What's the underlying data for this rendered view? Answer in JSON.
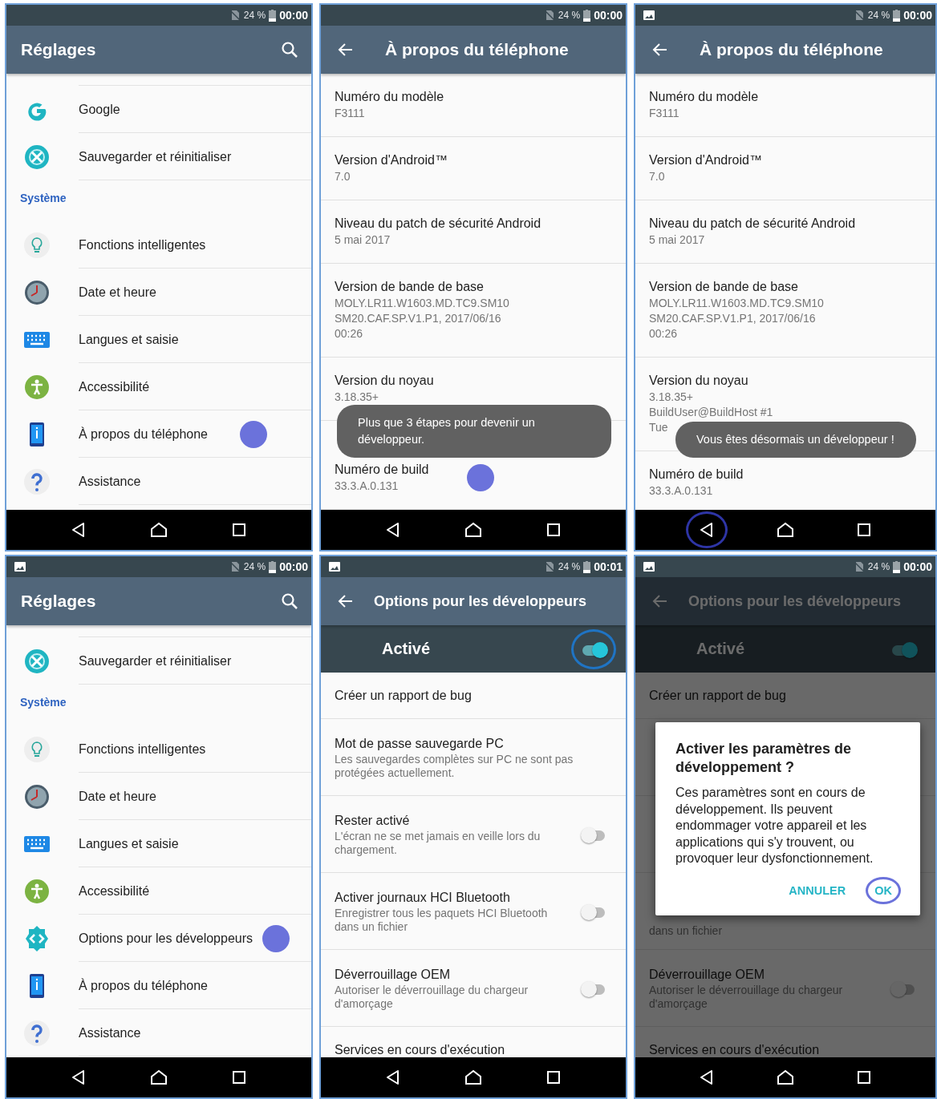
{
  "phones": [
    {
      "status": {
        "screenshot_icon": false,
        "battery": "24 %",
        "time": "00:00"
      },
      "appbar": {
        "title": "Réglages",
        "back": false,
        "search": true
      },
      "nav": {
        "back_highlighted": false
      },
      "settings": [
        {
          "kind": "google",
          "label": "Google",
          "tap": false
        },
        {
          "kind": "backup",
          "label": "Sauvegarder et réinitialiser",
          "tap": false
        },
        {
          "kind": "header",
          "label": "Système"
        },
        {
          "kind": "bulb",
          "label": "Fonctions intelligentes",
          "tap": false
        },
        {
          "kind": "clock",
          "label": "Date et heure",
          "tap": false
        },
        {
          "kind": "keyboard",
          "label": "Langues et saisie",
          "tap": false
        },
        {
          "kind": "accessibility",
          "label": "Accessibilité",
          "tap": false
        },
        {
          "kind": "phone",
          "label": "À propos du téléphone",
          "tap": true
        },
        {
          "kind": "help",
          "label": "Assistance",
          "tap": false
        }
      ]
    },
    {
      "status": {
        "screenshot_icon": false,
        "battery": "24 %",
        "time": "00:00"
      },
      "appbar": {
        "title": "À propos du téléphone",
        "back": true,
        "search": false
      },
      "nav": {
        "back_highlighted": false
      },
      "about": [
        {
          "title": "Numéro du modèle",
          "lines": [
            "F3111"
          ],
          "tap": false
        },
        {
          "title": "Version d'Android™",
          "lines": [
            "7.0"
          ],
          "tap": false
        },
        {
          "title": "Niveau du patch de sécurité Android",
          "lines": [
            "5 mai 2017"
          ],
          "tap": false
        },
        {
          "title": "Version de bande de base",
          "lines": [
            "MOLY.LR11.W1603.MD.TC9.SM10",
            "SM20.CAF.SP.V1.P1, 2017/06/16",
            "00:26"
          ],
          "tap": false
        },
        {
          "title": "Version du noyau",
          "lines": [
            "3.18.35+"
          ],
          "tap": false
        },
        {
          "title": "Numéro de build",
          "lines": [
            "33.3.A.0.131"
          ],
          "tap": true
        }
      ],
      "toast": "Plus que 3 étapes pour devenir un développeur."
    },
    {
      "status": {
        "screenshot_icon": true,
        "battery": "24 %",
        "time": "00:00"
      },
      "appbar": {
        "title": "À propos du téléphone",
        "back": true,
        "search": false
      },
      "nav": {
        "back_highlighted": true
      },
      "about": [
        {
          "title": "Numéro du modèle",
          "lines": [
            "F3111"
          ],
          "tap": false
        },
        {
          "title": "Version d'Android™",
          "lines": [
            "7.0"
          ],
          "tap": false
        },
        {
          "title": "Niveau du patch de sécurité Android",
          "lines": [
            "5 mai 2017"
          ],
          "tap": false
        },
        {
          "title": "Version de bande de base",
          "lines": [
            "MOLY.LR11.W1603.MD.TC9.SM10",
            "SM20.CAF.SP.V1.P1, 2017/06/16",
            "00:26"
          ],
          "tap": false
        },
        {
          "title": "Version du noyau",
          "lines": [
            "3.18.35+",
            "BuildUser@BuildHost #1",
            "Tue"
          ],
          "tap": false
        },
        {
          "title": "Numéro de build",
          "lines": [
            "33.3.A.0.131"
          ],
          "tap": false
        }
      ],
      "toast": "Vous êtes désormais un développeur !"
    },
    {
      "status": {
        "screenshot_icon": true,
        "battery": "24 %",
        "time": "00:00"
      },
      "appbar": {
        "title": "Réglages",
        "back": false,
        "search": true
      },
      "nav": {
        "back_highlighted": false
      },
      "settings": [
        {
          "kind": "backup",
          "label": "Sauvegarder et réinitialiser",
          "tap": false
        },
        {
          "kind": "header",
          "label": "Système"
        },
        {
          "kind": "bulb",
          "label": "Fonctions intelligentes",
          "tap": false
        },
        {
          "kind": "clock",
          "label": "Date et heure",
          "tap": false
        },
        {
          "kind": "keyboard",
          "label": "Langues et saisie",
          "tap": false
        },
        {
          "kind": "accessibility",
          "label": "Accessibilité",
          "tap": false
        },
        {
          "kind": "developer",
          "label": "Options pour les développeurs",
          "tap": true
        },
        {
          "kind": "phone",
          "label": "À propos du téléphone",
          "tap": false
        },
        {
          "kind": "help",
          "label": "Assistance",
          "tap": false
        }
      ]
    },
    {
      "status": {
        "screenshot_icon": true,
        "battery": "24 %",
        "time": "00:01"
      },
      "appbar": {
        "title": "Options pour les développeurs",
        "back": true,
        "search": false
      },
      "nav": {
        "back_highlighted": false
      },
      "master_switch": {
        "label": "Activé",
        "on": true,
        "highlighted": true
      },
      "options": [
        {
          "kind": "action",
          "title": "Créer un rapport de bug"
        },
        {
          "kind": "action",
          "title": "Mot de passe sauvegarde PC",
          "subtitle": "Les sauvegardes complètes sur PC ne sont pas protégées actuellement."
        },
        {
          "kind": "option",
          "title": "Rester activé",
          "subtitle": "L'écran ne se met jamais en veille lors du chargement.",
          "on": false
        },
        {
          "kind": "option",
          "title": "Activer journaux HCI Bluetooth",
          "subtitle": "Enregistrer tous les paquets HCI Bluetooth dans un fichier",
          "on": false
        },
        {
          "kind": "option",
          "title": "Déverrouillage OEM",
          "subtitle": "Autoriser le déverrouillage du chargeur d'amorçage",
          "on": false
        },
        {
          "kind": "action",
          "title": "Services en cours d'exécution"
        }
      ]
    },
    {
      "status": {
        "screenshot_icon": true,
        "battery": "24 %",
        "time": "00:00"
      },
      "appbar": {
        "title": "Options pour les développeurs",
        "back": true,
        "search": false
      },
      "nav": {
        "back_highlighted": false
      },
      "dimmed": true,
      "master_switch": {
        "label": "Activé",
        "on": true,
        "highlighted": false
      },
      "options": [
        {
          "kind": "action",
          "title": "Créer un rapport de bug"
        },
        {
          "kind": "covered"
        },
        {
          "kind": "covered"
        },
        {
          "kind": "tail",
          "subtitle": "dans un fichier"
        },
        {
          "kind": "option",
          "title": "Déverrouillage OEM",
          "subtitle": "Autoriser le déverrouillage du chargeur d'amorçage",
          "on": false
        },
        {
          "kind": "action",
          "title": "Services en cours d'exécution"
        }
      ],
      "dialog": {
        "title": "Activer les paramètres de développement ?",
        "message": "Ces paramètres sont en cours de développement. Ils peuvent endommager votre appareil et les applications qui s'y trouvent, ou provoquer leur dysfonctionnement.",
        "buttons": [
          {
            "label": "ANNULER",
            "highlighted": false
          },
          {
            "label": "OK",
            "highlighted": true
          }
        ]
      }
    }
  ]
}
